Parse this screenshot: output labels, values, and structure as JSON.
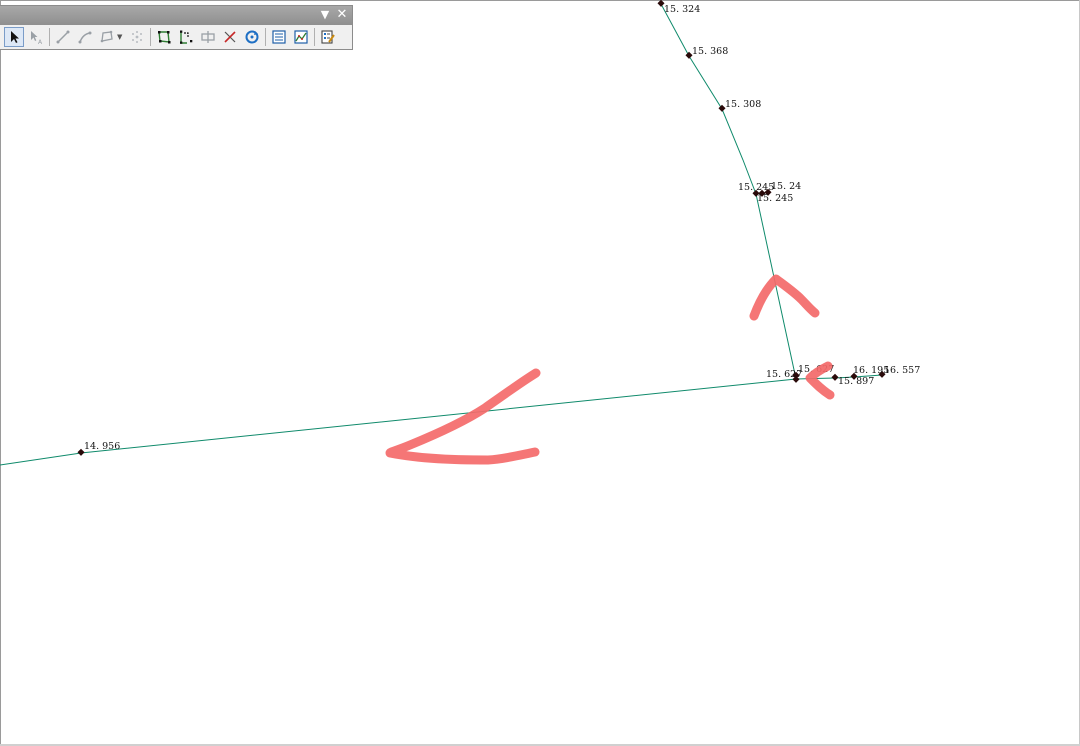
{
  "toolbar": {
    "menu_glyph": "▼",
    "close_glyph": "✕",
    "tools": [
      {
        "name": "select-arrow-icon",
        "active": true
      },
      {
        "name": "select-vertex-icon",
        "active": false
      },
      {
        "name": "straight-segment-icon",
        "active": false
      },
      {
        "name": "trace-segment-icon",
        "active": false
      },
      {
        "name": "polygon-tool-icon",
        "active": false
      },
      {
        "name": "points-cluster-icon",
        "active": false
      },
      {
        "name": "edit-vertices-icon",
        "active": false
      },
      {
        "name": "reshape-feature-icon",
        "active": false
      },
      {
        "name": "cut-polygon-icon",
        "active": false
      },
      {
        "name": "split-icon",
        "active": false
      },
      {
        "name": "rotate-icon",
        "active": false
      },
      {
        "name": "attributes-icon",
        "active": false
      },
      {
        "name": "sketch-properties-icon",
        "active": false
      },
      {
        "name": "create-features-icon",
        "active": false
      }
    ]
  },
  "map": {
    "line_color": "#0f8a6b",
    "vertex_color": "#2a0a0a",
    "annotation_color": "#f46a6a"
  },
  "labels": {
    "l1": "15. 324",
    "l2": "15. 368",
    "l3": "15. 308",
    "l4": "15. 245",
    "l5": "15. 24",
    "l6": "15. 245",
    "l7": "15. 627",
    "l8": "15. 627",
    "l9": "15. 897",
    "l10": "16. 195",
    "l11": "16. 557",
    "l12": "14. 956"
  }
}
